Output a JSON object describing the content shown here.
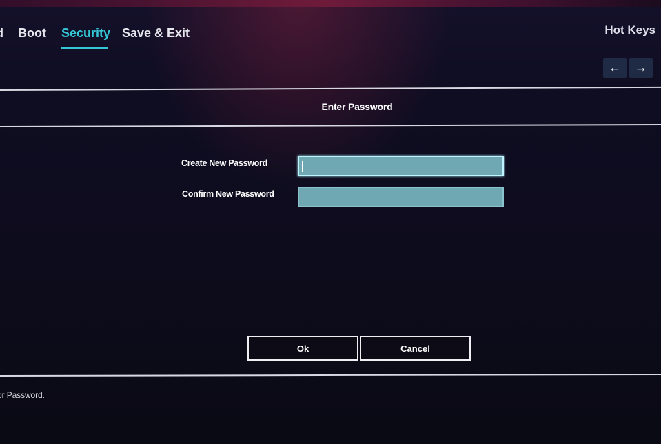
{
  "header": {
    "tabs": [
      {
        "label": "d"
      },
      {
        "label": "Boot"
      },
      {
        "label": "Security",
        "active": true
      },
      {
        "label": "Save & Exit"
      }
    ],
    "hot_keys_label": "Hot Keys",
    "nav_arrows": {
      "left": "←",
      "right": "→"
    }
  },
  "dialog": {
    "title": "Enter Password",
    "fields": [
      {
        "label": "Create New Password",
        "value": "",
        "focused": true
      },
      {
        "label": "Confirm New Password",
        "value": ""
      }
    ],
    "buttons": {
      "ok": "Ok",
      "cancel": "Cancel"
    }
  },
  "footer": {
    "help_text": "or Password."
  },
  "colors": {
    "accent": "#35c6d6",
    "input_fill": "#6fa8b2",
    "background": "#0d0c1c"
  }
}
